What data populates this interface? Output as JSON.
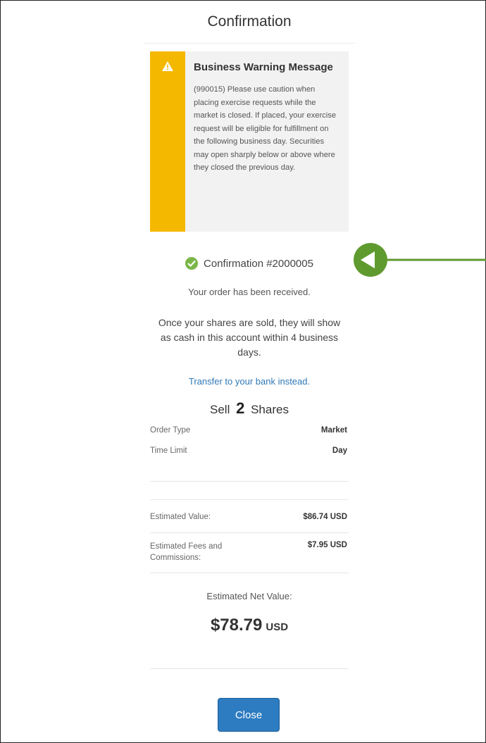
{
  "header": {
    "title": "Confirmation"
  },
  "warning": {
    "icon": "warning-icon",
    "title": "Business Warning Message",
    "text": "(990015) Please use caution when placing exercise requests while the market is closed. If placed, your exercise request will be eligible for fulfillment on the following business day. Securities may open sharply below or above where they closed the previous day.",
    "color": "#f5b800"
  },
  "confirmation": {
    "icon": "check-circle-icon",
    "label": "Confirmation #2000005",
    "received": "Your order has been received.",
    "message": "Once your shares are sold, they will show as cash in this account within 4 business days.",
    "transfer_link": "Transfer to your bank instead."
  },
  "order": {
    "sell_prefix": "Sell",
    "quantity": "2",
    "sell_suffix": "Shares",
    "rows": [
      {
        "label": "Order Type",
        "value": "Market"
      },
      {
        "label": "Time Limit",
        "value": "Day"
      }
    ]
  },
  "estimates": {
    "value_label": "Estimated Value:",
    "value": "$86.74 USD",
    "fees_label": "Estimated Fees and Commissions:",
    "fees": "$7.95 USD",
    "net_label": "Estimated Net Value:",
    "net_value": "$78.79",
    "net_unit": "USD"
  },
  "actions": {
    "close": "Close"
  },
  "colors": {
    "accent": "#2d7cc1",
    "success": "#7ab648",
    "annotation": "#5f9a2f"
  }
}
